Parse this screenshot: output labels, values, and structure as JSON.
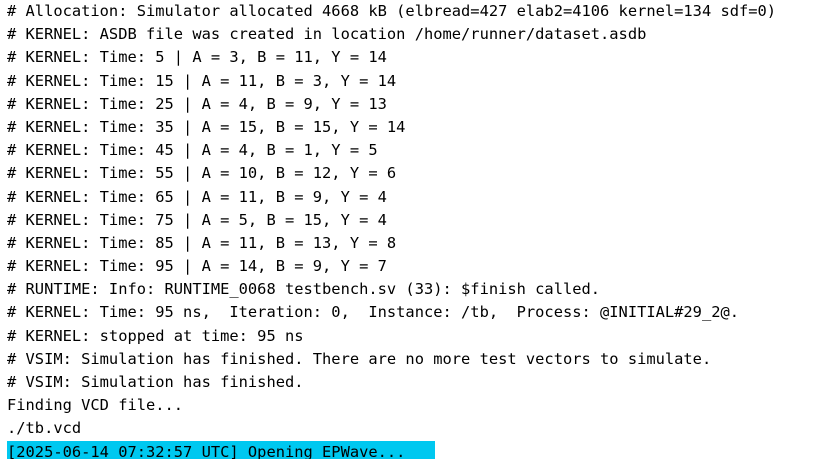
{
  "terminal": {
    "background": "#ffffff",
    "foreground": "#000000",
    "highlight_color": "#00c8f0",
    "lines": [
      "# Allocation: Simulator allocated 4668 kB (elbread=427 elab2=4106 kernel=134 sdf=0)",
      "# KERNEL: ASDB file was created in location /home/runner/dataset.asdb",
      "# KERNEL: Time: 5 | A = 3, B = 11, Y = 14",
      "# KERNEL: Time: 15 | A = 11, B = 3, Y = 14",
      "# KERNEL: Time: 25 | A = 4, B = 9, Y = 13",
      "# KERNEL: Time: 35 | A = 15, B = 15, Y = 14",
      "# KERNEL: Time: 45 | A = 4, B = 1, Y = 5",
      "# KERNEL: Time: 55 | A = 10, B = 12, Y = 6",
      "# KERNEL: Time: 65 | A = 11, B = 9, Y = 4",
      "# KERNEL: Time: 75 | A = 5, B = 15, Y = 4",
      "# KERNEL: Time: 85 | A = 11, B = 13, Y = 8",
      "# KERNEL: Time: 95 | A = 14, B = 9, Y = 7",
      "# RUNTIME: Info: RUNTIME_0068 testbench.sv (33): $finish called.",
      "# KERNEL: Time: 95 ns,  Iteration: 0,  Instance: /tb,  Process: @INITIAL#29_2@.",
      "# KERNEL: stopped at time: 95 ns",
      "# VSIM: Simulation has finished. There are no more test vectors to simulate.",
      "# VSIM: Simulation has finished.",
      "Finding VCD file...",
      "./tb.vcd"
    ],
    "highlighted_line": "[2025-06-14 07:32:57 UTC] Opening EPWave..."
  }
}
